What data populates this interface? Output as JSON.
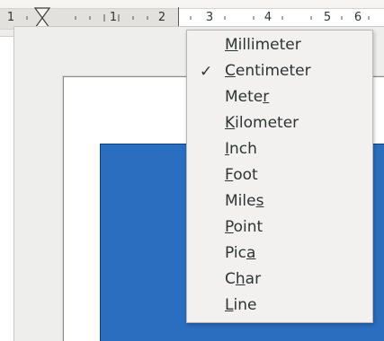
{
  "ruler": {
    "labels": [
      "1",
      "1",
      "2",
      "3",
      "4",
      "5",
      "6"
    ]
  },
  "unit_menu": {
    "items": [
      {
        "pre": "",
        "key": "M",
        "post": "illimeter",
        "checked": false
      },
      {
        "pre": "",
        "key": "C",
        "post": "entimeter",
        "checked": true
      },
      {
        "pre": "Mete",
        "key": "r",
        "post": "",
        "checked": false
      },
      {
        "pre": "",
        "key": "K",
        "post": "ilometer",
        "checked": false
      },
      {
        "pre": "",
        "key": "I",
        "post": "nch",
        "checked": false
      },
      {
        "pre": "",
        "key": "F",
        "post": "oot",
        "checked": false
      },
      {
        "pre": "Mile",
        "key": "s",
        "post": "",
        "checked": false
      },
      {
        "pre": "",
        "key": "P",
        "post": "oint",
        "checked": false
      },
      {
        "pre": "Pic",
        "key": "a",
        "post": "",
        "checked": false
      },
      {
        "pre": "C",
        "key": "h",
        "post": "ar",
        "checked": false
      },
      {
        "pre": "",
        "key": "L",
        "post": "ine",
        "checked": false
      }
    ],
    "check_glyph": "✓"
  },
  "colors": {
    "shape_fill": "#2a6ebf",
    "shape_border": "#143f7a",
    "menu_bg": "#f2f1f0",
    "text": "#2e3436"
  },
  "icons": {
    "indent_marker": "hourglass-indent-icon",
    "checked": "checkmark-icon"
  }
}
